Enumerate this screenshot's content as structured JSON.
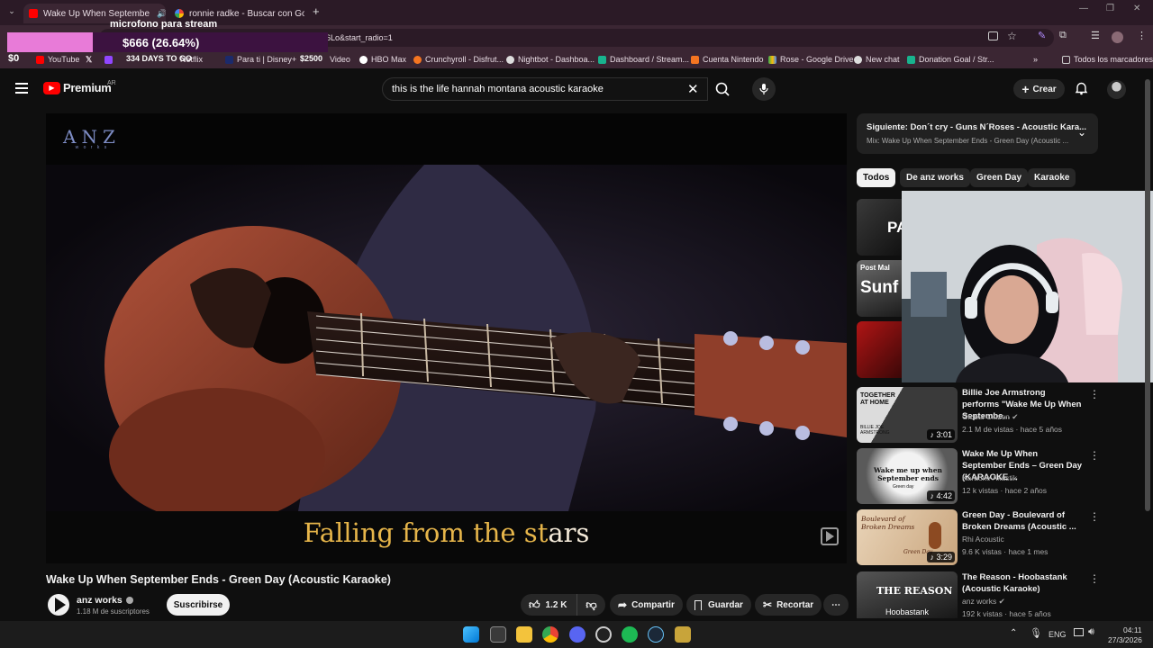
{
  "browser": {
    "tabs": [
      {
        "title": "Wake Up When Septembe",
        "active": true
      },
      {
        "title": "ronnie radke - Buscar con Goog",
        "active": false
      }
    ],
    "address": "6Lo&start_radio=1",
    "bookmarks": [
      "YouTube",
      "Netflix",
      "Para ti | Disney+",
      "Video",
      "HBO Max",
      "Crunchyroll - Disfrut...",
      "Nightbot - Dashboa...",
      "Dashboard / Stream...",
      "Cuenta Nintendo",
      "Rose - Google Drive",
      "New chat",
      "Donation Goal / Str..."
    ],
    "all_bookmarks": "Todos los marcadores"
  },
  "overlay": {
    "goal_title": "microfono para stream",
    "goal_amount": "$666 (26.64%)",
    "goal_progress": 0.2664,
    "ticker_left": "$0",
    "ticker_days": "334 DAYS TO GO",
    "ticker_amount": "$2500"
  },
  "youtube": {
    "brand": "Premium",
    "region": "AR",
    "search_query": "this is the life hannah montana acoustic karaoke",
    "create_label": "Crear",
    "video": {
      "watermark": "ANZ",
      "watermark_sub": "w o r k s",
      "lyric_sung": "Falling from the st",
      "lyric_rest": "ars",
      "title": "Wake Up When September Ends - Green Day (Acoustic Karaoke)",
      "channel": "anz works",
      "subscribers": "1.18 M de suscriptores",
      "subscribe_label": "Suscribirse",
      "likes": "1.2 K",
      "share_label": "Compartir",
      "save_label": "Guardar",
      "clip_label": "Recortar"
    },
    "up_next": {
      "title": "Siguiente: Don´t cry - Guns N´Roses - Acoustic Kara...",
      "subtitle": "Mix: Wake Up When September Ends - Green Day (Acoustic ..."
    },
    "chips": [
      "Todos",
      "De anz works",
      "Green Day",
      "Karaoke"
    ],
    "partial_thumbs": [
      "PA",
      "Post Mal",
      "Sunf"
    ],
    "recommendations": [
      {
        "title": "Billie Joe Armstrong performs \"Wake Me Up When Septembe...",
        "channel": "Global Citizen",
        "meta": "2.1 M de vistas · hace 5 años",
        "duration": "3:01",
        "thumb_text": "TOGETHER AT HOME",
        "thumb_caption": "BILLIE JOE ARMSTRONG"
      },
      {
        "title": "Wake Me Up When September Ends – Green Day (KARAOKE ...",
        "channel": "Karaoke Akustik",
        "meta": "12 k vistas · hace 2 años",
        "duration": "4:42",
        "thumb_text": "Wake me up when September ends",
        "thumb_caption": "Green day"
      },
      {
        "title": "Green Day - Boulevard of Broken Dreams (Acoustic ...",
        "channel": "Rhi Acoustic",
        "meta": "9.6 K vistas · hace 1 mes",
        "duration": "3:29",
        "thumb_text": "Boulevard of Broken Dreams",
        "thumb_caption": "Green Day"
      },
      {
        "title": "The Reason - Hoobastank (Acoustic Karaoke)",
        "channel": "anz works",
        "meta": "192 k vistas · hace 5 años",
        "duration": "",
        "thumb_text": "THE REASON",
        "thumb_caption": "Hoobastank"
      }
    ]
  },
  "taskbar": {
    "language": "ENG",
    "time": "04:11",
    "date": "27/3/2026"
  },
  "colors": {
    "youtube_red": "#ff0000",
    "overlay_pink": "#e87bd8",
    "lyric_gold": "#e6b54a",
    "lyric_white": "#f4ead9"
  }
}
